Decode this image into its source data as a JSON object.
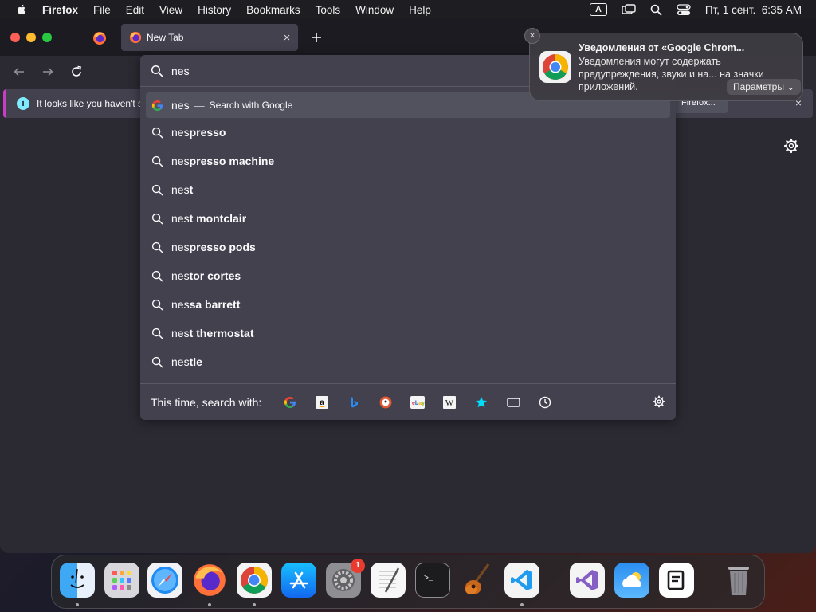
{
  "menubar": {
    "app_name": "Firefox",
    "items": [
      "File",
      "Edit",
      "View",
      "History",
      "Bookmarks",
      "Tools",
      "Window",
      "Help"
    ],
    "input_indicator": "A",
    "clock": "Пт, 1 сент.  6:35 AM"
  },
  "tabs": {
    "active_title": "New Tab",
    "close_glyph": "×",
    "new_tab_glyph": "+"
  },
  "infobar": {
    "message": "It looks like you haven't st",
    "button_label": "Firefox...",
    "close_glyph": "×",
    "info_glyph": "i"
  },
  "urlbar": {
    "value": "nes",
    "results": [
      {
        "typed": "nes",
        "rest": "",
        "action": "Search with Google",
        "type": "engine"
      },
      {
        "typed": "nes",
        "rest": "presso",
        "type": "suggestion"
      },
      {
        "typed": "nes",
        "rest": "presso machine",
        "type": "suggestion"
      },
      {
        "typed": "nes",
        "rest": "t",
        "type": "suggestion"
      },
      {
        "typed": "nes",
        "rest": "t montclair",
        "type": "suggestion"
      },
      {
        "typed": "nes",
        "rest": "presso pods",
        "type": "suggestion"
      },
      {
        "typed": "nes",
        "rest": "tor cortes",
        "type": "suggestion"
      },
      {
        "typed": "nes",
        "rest": "sa barrett",
        "type": "suggestion"
      },
      {
        "typed": "nes",
        "rest": "t thermostat",
        "type": "suggestion"
      },
      {
        "typed": "nes",
        "rest": "tle",
        "type": "suggestion"
      }
    ],
    "separator": "—",
    "oneoff_label": "This time, search with:",
    "engines": [
      "google-icon",
      "amazon-icon",
      "bing-icon",
      "duckduckgo-icon",
      "ebay-icon",
      "wikipedia-icon",
      "bookmarks-star-icon",
      "tabs-icon",
      "history-icon"
    ]
  },
  "notification": {
    "title": "Уведомления от «Google Chrom...",
    "body": "Уведомления могут содержать предупреждения, звуки и на... на значки приложений.",
    "options_label": "Параметры ⌄",
    "close_glyph": "×"
  },
  "dock": {
    "apps": [
      "Finder",
      "Launchpad",
      "Safari",
      "Firefox",
      "Google Chrome",
      "App Store",
      "System Settings",
      "TextEdit",
      "Terminal",
      "GarageBand",
      "Visual Studio Code",
      "Visual Studio",
      "Weather",
      "Notes Widget",
      "Trash"
    ],
    "settings_badge": "1",
    "colors": {
      "accent": "#0a84ff",
      "badge": "#e93b2f"
    }
  }
}
